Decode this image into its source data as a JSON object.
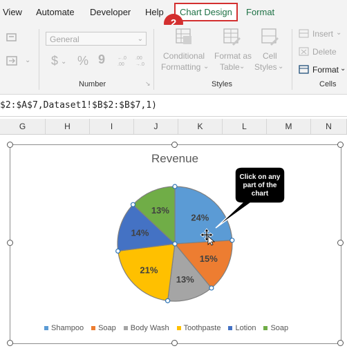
{
  "menu": {
    "tabs": [
      {
        "label": "View"
      },
      {
        "label": "Automate"
      },
      {
        "label": "Developer"
      },
      {
        "label": "Help"
      },
      {
        "label": "Chart Design"
      },
      {
        "label": "Format"
      }
    ],
    "step_badge": "2"
  },
  "ribbon": {
    "number_format": "General",
    "number_group_label": "Number",
    "styles_group_label": "Styles",
    "cells_group_label": "Cells",
    "conditional_formatting": [
      "Conditional",
      "Formatting"
    ],
    "format_as_table": [
      "Format as",
      "Table"
    ],
    "cell_styles": [
      "Cell",
      "Styles"
    ],
    "insert": "Insert",
    "delete": "Delete",
    "format": "Format",
    "currency_symbol": "$",
    "percent_symbol": "%",
    "comma_symbol": "9"
  },
  "formula_bar": {
    "text": "$2:$A$7,Dataset1!$B$2:$B$7,1)"
  },
  "columns": [
    "G",
    "H",
    "I",
    "J",
    "K",
    "L",
    "M",
    "N"
  ],
  "callout": {
    "text_lines": [
      "Click on any",
      "part of the",
      "chart"
    ]
  },
  "chart_data": {
    "type": "pie",
    "title": "Revenue",
    "categories": [
      "Shampoo",
      "Soap",
      "Body Wash",
      "Toothpaste",
      "Lotion",
      "Soap"
    ],
    "values": [
      24,
      15,
      13,
      21,
      14,
      13
    ],
    "value_labels": [
      "24%",
      "15%",
      "13%",
      "21%",
      "14%",
      "13%"
    ],
    "colors": [
      "#5b9bd5",
      "#ed7d31",
      "#a5a5a5",
      "#ffc000",
      "#4472c4",
      "#70ad47"
    ],
    "legend_position": "bottom",
    "selected_slice_index": 1
  }
}
